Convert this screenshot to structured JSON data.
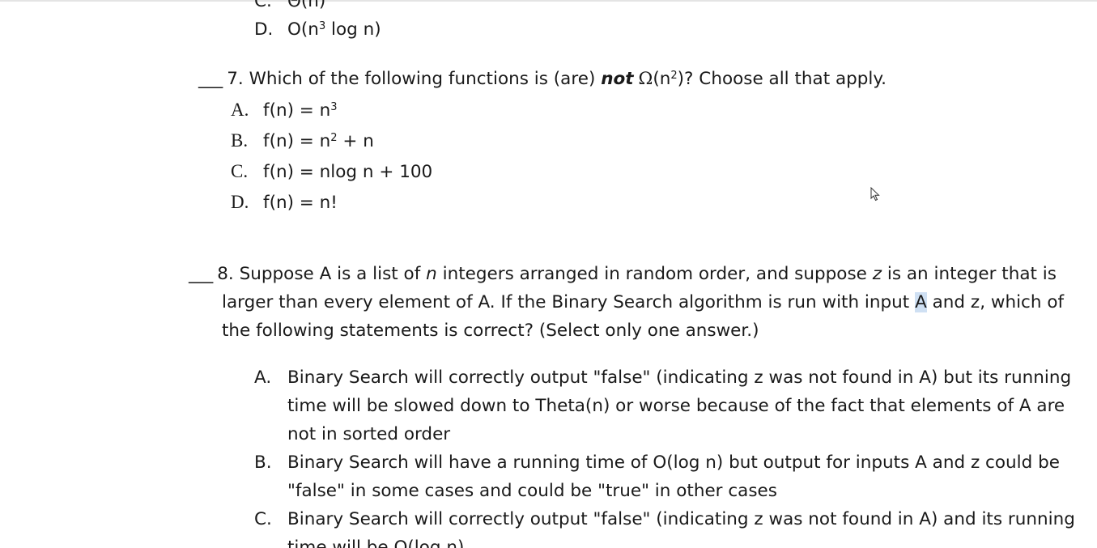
{
  "q6_tail": {
    "option_c": {
      "label": "C.",
      "text": "Θ(n)"
    },
    "option_d": {
      "label": "D.",
      "text_prefix": "O(n",
      "sup": "3",
      "text_suffix": " log n)"
    }
  },
  "q7": {
    "blank": "___",
    "prompt_number": "7.",
    "prompt_start": "Which of the following functions is (are)",
    "prompt_emph": "not",
    "prompt_omega": "Ω",
    "prompt_arg_prefix": "(n",
    "prompt_arg_sup": "2",
    "prompt_arg_suffix": ")? Choose all that apply.",
    "options": [
      {
        "label": "A.",
        "text_prefix": "f(n) = n",
        "sup": "3",
        "text_suffix": ""
      },
      {
        "label": "B.",
        "text_prefix": "f(n) = n",
        "sup": "2",
        "text_suffix": " + n"
      },
      {
        "label": "C.",
        "text_prefix": "f(n) = nlog n + 100",
        "sup": "",
        "text_suffix": ""
      },
      {
        "label": "D.",
        "text_prefix": "f(n) = n!",
        "sup": "",
        "text_suffix": ""
      }
    ]
  },
  "q8": {
    "blank": "___",
    "prompt_line1_a": "8. Suppose A is a list of ",
    "prompt_line1_n": "n",
    "prompt_line1_b": " integers arranged in random order, and suppose ",
    "prompt_line1_z": "z",
    "prompt_line1_c": " is an integer that is",
    "prompt_line2_a": "larger than every element of A. If the Binary Search algorithm is run with input ",
    "prompt_line2_highlight": "A",
    "prompt_line2_b": " and z, which of",
    "prompt_line3": "the following statements is correct? (Select only one answer.)",
    "options": [
      {
        "label": "A.",
        "lines": [
          "Binary Search will correctly output \"false\" (indicating z was not found in A) but its running",
          "time will be slowed down to Theta(n) or worse because of the fact that elements of A are",
          "not in sorted order"
        ]
      },
      {
        "label": "B.",
        "lines": [
          "Binary Search will have a running time of O(log n) but output for inputs A and z could be",
          "\"false\" in some cases and could be \"true\" in other cases"
        ]
      },
      {
        "label": "C.",
        "lines": [
          "Binary Search will correctly output \"false\" (indicating z was not found in A) and its running",
          "time will be O(log n)"
        ]
      }
    ]
  },
  "cursor_icon": "mouse-pointer-icon"
}
